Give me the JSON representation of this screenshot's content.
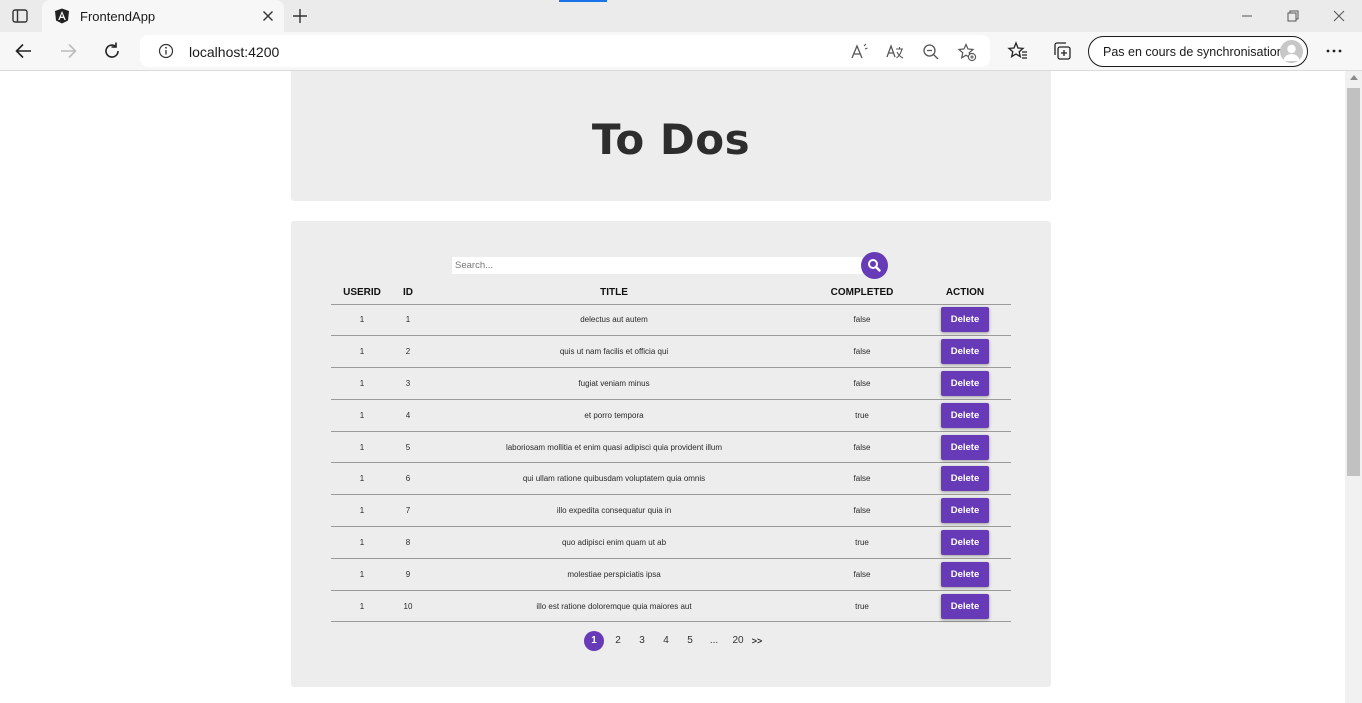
{
  "browser": {
    "tab_title": "FrontendApp",
    "address": "localhost:4200",
    "sync_label": "Pas en cours de synchronisation"
  },
  "page": {
    "title": "To Dos"
  },
  "search": {
    "placeholder": "Search..."
  },
  "table": {
    "headers": {
      "userid": "USERID",
      "id": "ID",
      "title": "TITLE",
      "completed": "COMPLETED",
      "action": "ACTION"
    },
    "rows": [
      {
        "userId": "1",
        "id": "1",
        "title": "delectus aut autem",
        "completed": "false",
        "action": "Delete"
      },
      {
        "userId": "1",
        "id": "2",
        "title": "quis ut nam facilis et officia qui",
        "completed": "false",
        "action": "Delete"
      },
      {
        "userId": "1",
        "id": "3",
        "title": "fugiat veniam minus",
        "completed": "false",
        "action": "Delete"
      },
      {
        "userId": "1",
        "id": "4",
        "title": "et porro tempora",
        "completed": "true",
        "action": "Delete"
      },
      {
        "userId": "1",
        "id": "5",
        "title": "laboriosam mollitia et enim quasi adipisci quia provident illum",
        "completed": "false",
        "action": "Delete"
      },
      {
        "userId": "1",
        "id": "6",
        "title": "qui ullam ratione quibusdam voluptatem quia omnis",
        "completed": "false",
        "action": "Delete"
      },
      {
        "userId": "1",
        "id": "7",
        "title": "illo expedita consequatur quia in",
        "completed": "false",
        "action": "Delete"
      },
      {
        "userId": "1",
        "id": "8",
        "title": "quo adipisci enim quam ut ab",
        "completed": "true",
        "action": "Delete"
      },
      {
        "userId": "1",
        "id": "9",
        "title": "molestiae perspiciatis ipsa",
        "completed": "false",
        "action": "Delete"
      },
      {
        "userId": "1",
        "id": "10",
        "title": "illo est ratione doloremque quia maiores aut",
        "completed": "true",
        "action": "Delete"
      }
    ]
  },
  "pagination": {
    "pages": [
      "1",
      "2",
      "3",
      "4",
      "5",
      "...",
      "20",
      ">>"
    ],
    "current": "1"
  },
  "colors": {
    "accent": "#673ab7",
    "card": "#ededed"
  }
}
